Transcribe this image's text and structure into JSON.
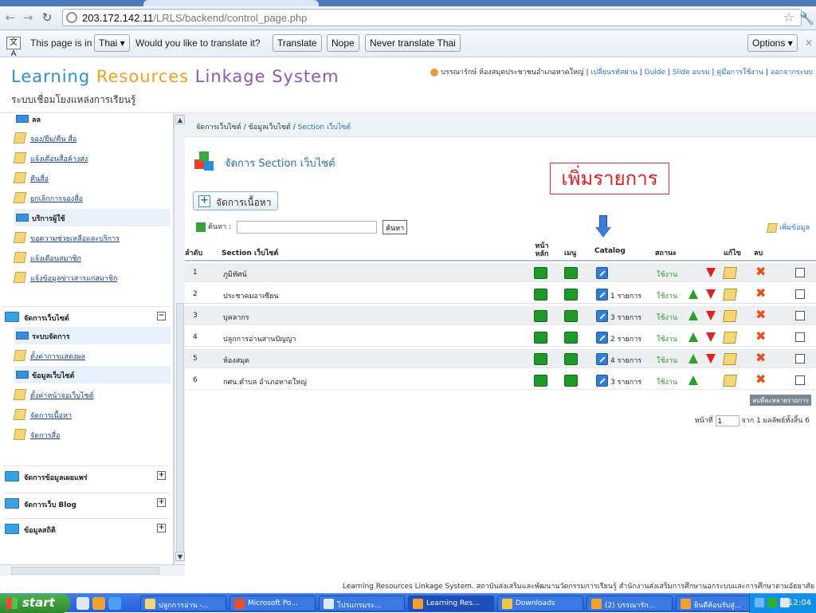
{
  "browser": {
    "url_host": "203.172.142.11",
    "url_path": "/LRLS/backend/control_page.php"
  },
  "translate_bar": {
    "prefix": "This page is in",
    "language": "Thai",
    "question": "Would you like to translate it?",
    "translate": "Translate",
    "nope": "Nope",
    "never": "Never translate Thai",
    "options": "Options"
  },
  "header": {
    "logo_part1": "Learning",
    "logo_part2": "Resources",
    "logo_part3": "Linkage System",
    "subtitle": "ระบบเชื่อมโยงแหล่งการเรียนรู้",
    "user": "บรรณารักษ์ ห้องสมุดประชาชนอำเภอหาดใหญ่",
    "links": [
      "เปลี่ยนรหัสผ่าน",
      "Guide",
      "Slide อบรม",
      "คู่มือการใช้งาน",
      "ออกจากระบบ"
    ]
  },
  "sidebar": {
    "top_items": [
      "ลล",
      "จอง/ยืม/คืน สื่อ",
      "แจ้งเตือนสื่อค้างส่ง",
      "คืนสื่อ",
      "ยกเลิกการจองสื่อ"
    ],
    "member_header": "บริการผู้ใช้",
    "member_items": [
      "ขอความช่วยเหลือและบริการ",
      "แจ้งเตือนสมาชิก",
      "แจ้งข้อมูลข่าวสารแก่สมาชิก"
    ],
    "group_website": "จัดการเว็บไซต์",
    "system_header": "ระบบจัดการ",
    "system_items": [
      "ตั้งค่าการแสดงผล"
    ],
    "info_header": "ข้อมูลเว็บไซต์",
    "info_items": [
      "ตั้งค่าหน้าจอเว็บไซต์",
      "จัดการเนื้อหา",
      "จัดการสื่อ"
    ],
    "group_publish": "จัดการข้อมูลเผยแพร่",
    "group_blog": "จัดการเว็บ Blog",
    "group_stats": "ข้อมูลสถิติ"
  },
  "main": {
    "breadcrumb": "จัดการเว็บไซต์ / ข้อมูลเว็บไซต์ /",
    "breadcrumb_current": "Section เว็บไซต์",
    "title": "จัดการ Section เว็บไซต์",
    "annotation": "เพิ่มรายการ",
    "content_button": "จัดการเนื้อหา",
    "search_label": "ค้นหา :",
    "search_value": "",
    "search_button": "ค้นหา",
    "add_link": "เพิ่มข้อมูล",
    "columns": [
      "ลำดับ",
      "Section เว็บไซต์",
      "หน้าหลัก",
      "เมนู",
      "Catalog",
      "สถานะ",
      "แก้ไข",
      "ลบ"
    ],
    "rows": [
      {
        "no": "1",
        "name": "ภูมิทัศน์",
        "catalog": "",
        "status": "ใช้งาน"
      },
      {
        "no": "2",
        "name": "ประชาคมอาเซียน",
        "catalog": "1 รายการ",
        "status": "ใช้งาน"
      },
      {
        "no": "3",
        "name": "บุคลากร",
        "catalog": "3 รายการ",
        "status": "ใช้งาน"
      },
      {
        "no": "4",
        "name": "ปลูกการอ่านสานปัญญา",
        "catalog": "2 รายการ",
        "status": "ใช้งาน"
      },
      {
        "no": "5",
        "name": "ห้องสมุด",
        "catalog": "4 รายการ",
        "status": "ใช้งาน"
      },
      {
        "no": "6",
        "name": "กศน.ตำบล อำเภอหาดใหญ่",
        "catalog": "3 รายการ",
        "status": "ใช้งาน"
      }
    ],
    "delete_selected": "ลบที่ละหลายรายการ",
    "pager_prefix": "หน้าที่",
    "pager_value": "1",
    "pager_suffix": "จาก 1  ผลลัพธ์ทั้งสิ้น 6"
  },
  "footer": "Learning Resources Linkage System. สถาบันส่งเสริมและพัฒนานวัตกรรมการเรียนรู้ สำนักงานส่งเสริมการศึกษานอกระบบและการศึกษาตามอัธยาศัย",
  "taskbar": {
    "start": "start",
    "tasks": [
      "ปลูกการอ่าน -...",
      "Microsoft Po...",
      "โปรแกรมระ...",
      "Learning Res...",
      "Downloads",
      "(2) บรรณารัก...",
      "ยินดีต้อนรับสู่..."
    ],
    "clock": "12:04"
  },
  "colors": {
    "accent": "#2a6fb7",
    "status_green": "#2a9a2a",
    "annotation_red": "#e02020"
  }
}
